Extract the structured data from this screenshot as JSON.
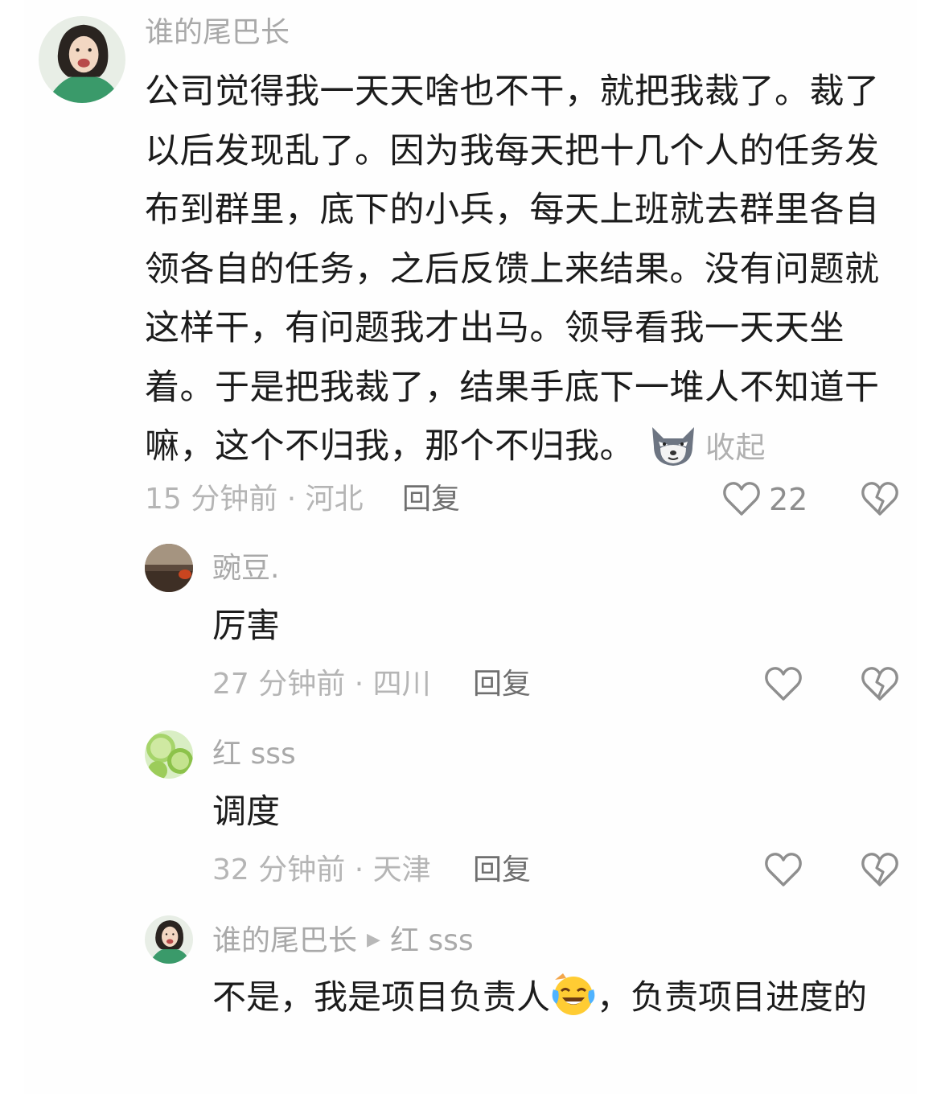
{
  "main_comment": {
    "author": "谁的尾巴长",
    "text": "公司觉得我一天天啥也不干，就把我裁了。裁了以后发现乱了。因为我每天把十几个人的任务发布到群里，底下的小兵，每天上班就去群里各自领各自的任务，之后反馈上来结果。没有问题就这样干，有问题我才出马。领导看我一天天坐着。于是把我裁了，结果手底下一堆人不知道干嘛，这个不归我，那个不归我。",
    "emoji": "wolf-head-emoji",
    "collapse_label": "收起",
    "meta": "15 分钟前 · 河北",
    "reply_label": "回复",
    "like_count": "22"
  },
  "replies": [
    {
      "author": "豌豆.",
      "text": "厉害",
      "meta": "27 分钟前 · 四川",
      "reply_label": "回复"
    },
    {
      "author": "红 sss",
      "text": "调度",
      "meta": "32 分钟前 · 天津",
      "reply_label": "回复"
    },
    {
      "author": "谁的尾巴长",
      "reply_to": "红 sss",
      "text_before": "不是，我是项目负责人",
      "emoji": "laughing-tears-emoji",
      "text_after": "，负责项目进度的"
    }
  ],
  "icons": {
    "like": "heart-outline-icon",
    "dislike": "broken-heart-icon",
    "reply_arrow": "caret-right-icon"
  },
  "colors": {
    "text": "#1c1c1c",
    "muted": "#a9a9a9",
    "icon": "#8e8e8e",
    "reply_link": "#6f6f6f"
  }
}
